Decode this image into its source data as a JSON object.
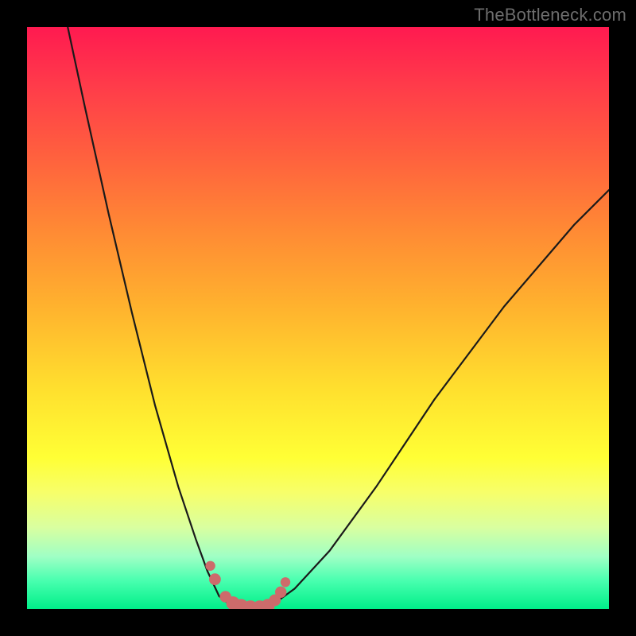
{
  "watermark": "TheBottleneck.com",
  "colors": {
    "frame": "#000000",
    "curve_stroke": "#1a1a1a",
    "marker_fill": "#cd6b6b",
    "gradient_top": "#ff1a50",
    "gradient_bottom": "#00ef89"
  },
  "chart_data": {
    "type": "line",
    "title": "",
    "xlabel": "",
    "ylabel": "",
    "xlim": [
      0,
      100
    ],
    "ylim": [
      0,
      100
    ],
    "series": [
      {
        "name": "left-branch",
        "x": [
          7,
          10,
          14,
          18,
          22,
          26,
          29,
          31,
          33,
          35
        ],
        "y": [
          100,
          86,
          68,
          51,
          35,
          21,
          12,
          6.5,
          2.2,
          0.6
        ]
      },
      {
        "name": "valley",
        "x": [
          35,
          36,
          37,
          38,
          39,
          40,
          41,
          42
        ],
        "y": [
          0.6,
          0.18,
          0.05,
          0.02,
          0.02,
          0.05,
          0.18,
          0.6
        ]
      },
      {
        "name": "right-branch",
        "x": [
          42,
          46,
          52,
          60,
          70,
          82,
          94,
          100
        ],
        "y": [
          0.6,
          3.5,
          10,
          21,
          36,
          52,
          66,
          72
        ]
      }
    ],
    "markers": {
      "name": "highlighted-points",
      "x": [
        31.5,
        32.3,
        34.1,
        35.4,
        36.8,
        38.4,
        40.0,
        41.4,
        42.6,
        43.6,
        44.4
      ],
      "y": [
        7.4,
        5.1,
        2.1,
        1.0,
        0.45,
        0.22,
        0.22,
        0.55,
        1.5,
        2.9,
        4.6
      ],
      "r": [
        6.2,
        7.4,
        7.2,
        8.6,
        9.2,
        9.2,
        9.2,
        8.6,
        7.4,
        7.2,
        6.2
      ]
    }
  }
}
